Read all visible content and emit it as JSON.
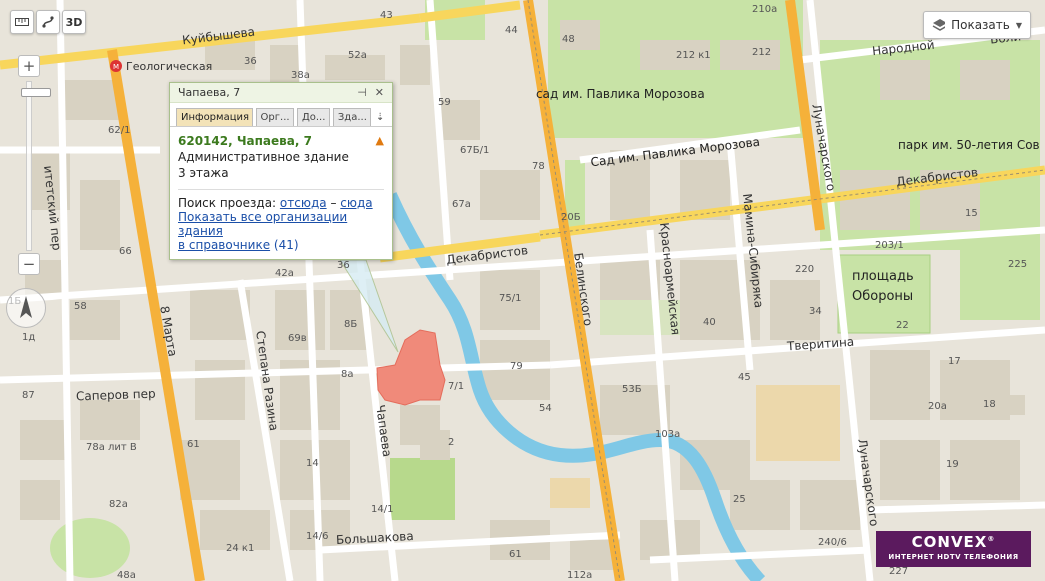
{
  "toolbar": {
    "ruler_icon": "ruler-icon",
    "routing_icon": "routing-icon",
    "view3d_label": "3D"
  },
  "layers": {
    "label": "Показать",
    "icon": "layers-icon"
  },
  "metro": {
    "name": "Геологическая"
  },
  "streets": {
    "kuybysheva": "Куйбышева",
    "narodnoy": "Народной",
    "volya": "Воли",
    "mart8": "8 Марта",
    "stepana": "Степана Разина",
    "chapaeva": "Чапаева",
    "saperov": "Саперов пер",
    "bolshakova": "Большакова",
    "dekabristov1": "Декабристов",
    "dekabristov2": "Декабристов",
    "belinskogo": "Белинского",
    "krasnoarm": "Красноармейская",
    "mamina": "Мамина-Сибиряка",
    "lunach1": "Луначарского",
    "lunach2": "Луначарского",
    "tveritina": "Тверитина",
    "lit": "итетский пер"
  },
  "parks": {
    "morozova1": "сад им. Павлика Морозова",
    "morozova2": "Сад им. Павлика Морозова",
    "park50": "парк им. 50-летия Сов",
    "ploshad1": "площадь",
    "ploshad2": "Обороны"
  },
  "house_numbers": [
    "43",
    "44",
    "210а",
    "36",
    "52а",
    "38а",
    "59",
    "48",
    "212 к1",
    "212",
    "62/1",
    "67Б/1",
    "78",
    "20Б",
    "67а",
    "66",
    "42а",
    "36",
    "75/1",
    "40",
    "220",
    "15",
    "203/1",
    "225",
    "8Б",
    "69в",
    "8а",
    "79",
    "34",
    "22",
    "17",
    "45",
    "7/1",
    "53Б",
    "54",
    "20а",
    "18",
    "87",
    "61",
    "2",
    "103а",
    "14",
    "19",
    "78а лит В",
    "82а",
    "14/1",
    "25",
    "24 к1",
    "14/6",
    "61",
    "240/6",
    "48а",
    "112а",
    "227",
    "1Б",
    "1д",
    "58"
  ],
  "balloon": {
    "title": "Чапаева, 7",
    "pin_icon": "pin-icon",
    "close_icon": "close-icon",
    "tabs": [
      "Информация",
      "Орг...",
      "До...",
      "Зда..."
    ],
    "more": "⇣",
    "address": "620142, Чапаева, 7",
    "type": "Административное здание",
    "floors": "3 этажа",
    "route_label": "Поиск проезда:",
    "route_from": "отсюда",
    "route_dash": "–",
    "route_to": "сюда",
    "show_all": "Показать все организации здания",
    "in_directory": "в справочнике",
    "count": "(41)"
  },
  "logo": {
    "name": "CONVEX",
    "mark": "®",
    "tagline": "ИНТЕРНЕТ HDTV ТЕЛЕФОНИЯ"
  },
  "colors": {
    "road_yellow": "#f8d65c",
    "road_orange": "#f5b13a",
    "river": "#7fc8e6",
    "park": "#c9e4a7",
    "building": "#d9d3c3",
    "selected_building": "#f08a7a"
  }
}
